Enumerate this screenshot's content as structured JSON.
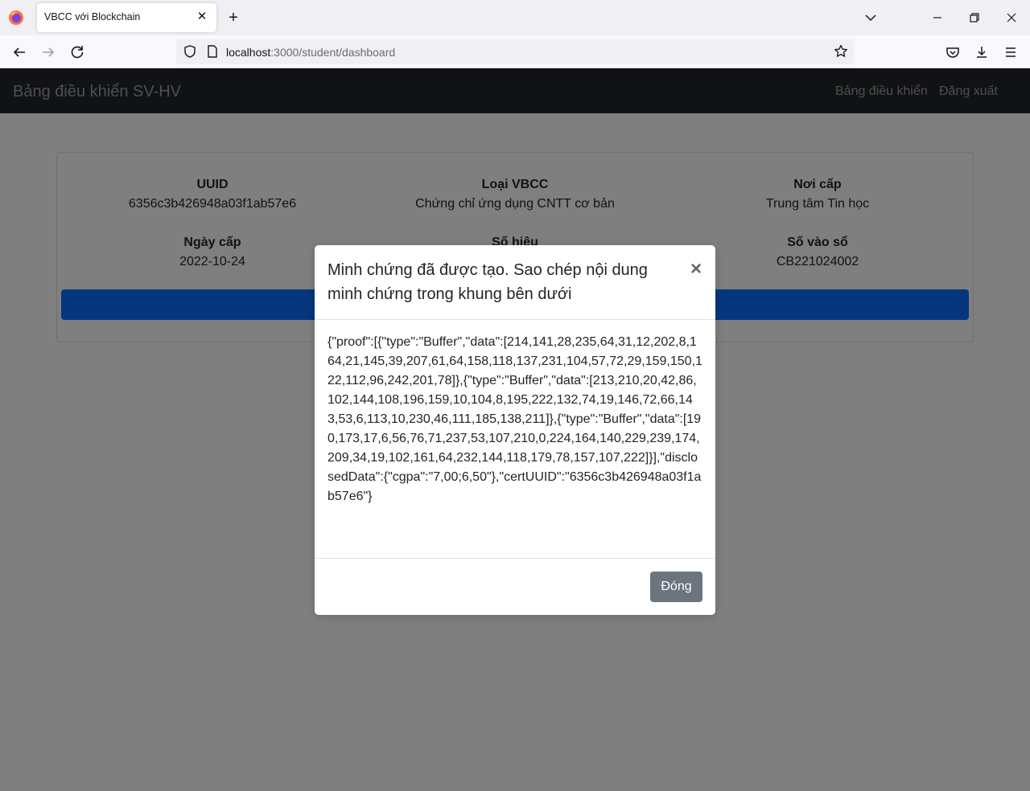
{
  "browser": {
    "tab_title": "VBCC với Blockchain",
    "url_host": "localhost",
    "url_rest": ":3000/student/dashboard"
  },
  "app": {
    "brand": "Bảng điều khiển SV-HV",
    "nav": {
      "dashboard": "Bảng điều khiển",
      "logout": "Đăng xuất"
    }
  },
  "certificate": {
    "uuid_label": "UUID",
    "uuid_value": "6356c3b426948a03f1ab57e6",
    "type_label": "Loại VBCC",
    "type_value": "Chứng chỉ ứng dụng CNTT cơ bản",
    "issuer_label": "Nơi cấp",
    "issuer_value": "Trung tâm Tin học",
    "date_label": "Ngày cấp",
    "date_value": "2022-10-24",
    "serial_label": "Số hiệu",
    "register_label": "Số vào sổ",
    "register_value": "CB221024002"
  },
  "modal": {
    "title": "Minh chứng đã được tạo. Sao chép nội dung minh chứng trong khung bên dưới",
    "body": "{\"proof\":[{\"type\":\"Buffer\",\"data\":[214,141,28,235,64,31,12,202,8,164,21,145,39,207,61,64,158,118,137,231,104,57,72,29,159,150,122,112,96,242,201,78]},{\"type\":\"Buffer\",\"data\":[213,210,20,42,86,102,144,108,196,159,10,104,8,195,222,132,74,19,146,72,66,143,53,6,113,10,230,46,111,185,138,211]},{\"type\":\"Buffer\",\"data\":[190,173,17,6,56,76,71,237,53,107,210,0,224,164,140,229,239,174,209,34,19,102,161,64,232,144,118,179,78,157,107,222]}],\"disclosedData\":{\"cgpa\":\"7,00;6,50\"},\"certUUID\":\"6356c3b426948a03f1ab57e6\"}",
    "close_label": "Đóng"
  }
}
